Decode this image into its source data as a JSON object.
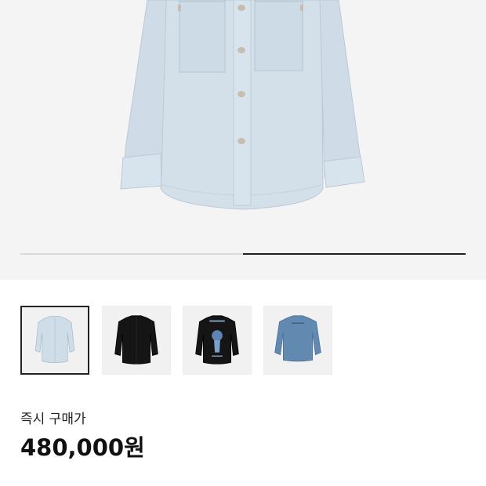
{
  "gallery": {
    "progress_fraction": 0.5,
    "active_slide_index": 1,
    "selected_thumbnail_index": 0,
    "thumbnails": [
      {
        "name": "light-blue-denim-shirt-front",
        "color": "#cfdde8"
      },
      {
        "name": "black-shirt-front",
        "color": "#151515"
      },
      {
        "name": "black-shirt-back-graphic",
        "color": "#151515"
      },
      {
        "name": "blue-denim-shirt-back",
        "color": "#6289b0"
      }
    ],
    "hero_color": "#cfdde8"
  },
  "price": {
    "label": "즉시 구매가",
    "value": "480,000원"
  },
  "colors": {
    "accent": "#222222",
    "hero_background": "#f4f4f4"
  }
}
